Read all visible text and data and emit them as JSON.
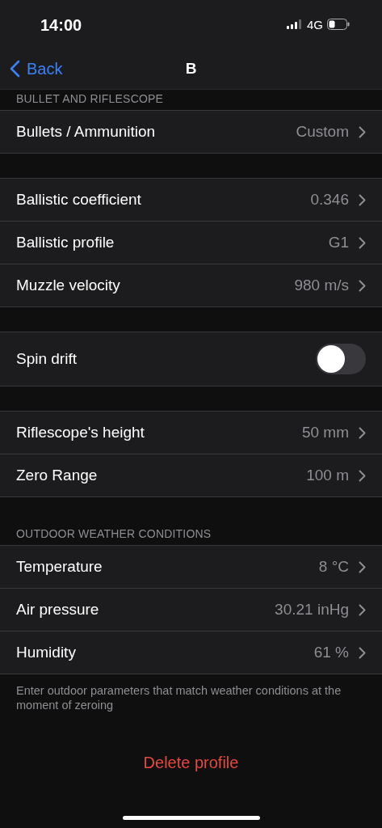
{
  "status_bar": {
    "time": "14:00",
    "network": "4G"
  },
  "nav": {
    "back": "Back",
    "title": "B"
  },
  "sections": [
    {
      "header": "BULLET AND RIFLESCOPE",
      "groups": [
        [
          {
            "kind": "value",
            "label": "Bullets / Ammunition",
            "value": "Custom"
          }
        ],
        [
          {
            "kind": "value",
            "label": "Ballistic coefficient",
            "value": "0.346"
          },
          {
            "kind": "value",
            "label": "Ballistic profile",
            "value": "G1"
          },
          {
            "kind": "value",
            "label": "Muzzle velocity",
            "value": "980 m/s"
          }
        ],
        [
          {
            "kind": "toggle",
            "label": "Spin drift",
            "on": false
          }
        ],
        [
          {
            "kind": "value",
            "label": "Riflescope's height",
            "value": "50 mm"
          },
          {
            "kind": "value",
            "label": "Zero Range",
            "value": "100 m"
          }
        ]
      ]
    },
    {
      "header": "OUTDOOR WEATHER CONDITIONS",
      "groups": [
        [
          {
            "kind": "value",
            "label": "Temperature",
            "value": "8 °C"
          },
          {
            "kind": "value",
            "label": "Air pressure",
            "value": "30.21 inHg"
          },
          {
            "kind": "value",
            "label": "Humidity",
            "value": "61 %"
          }
        ]
      ],
      "footer": "Enter outdoor parameters that match weather conditions at the moment of zeroing"
    }
  ],
  "delete_button": "Delete profile"
}
